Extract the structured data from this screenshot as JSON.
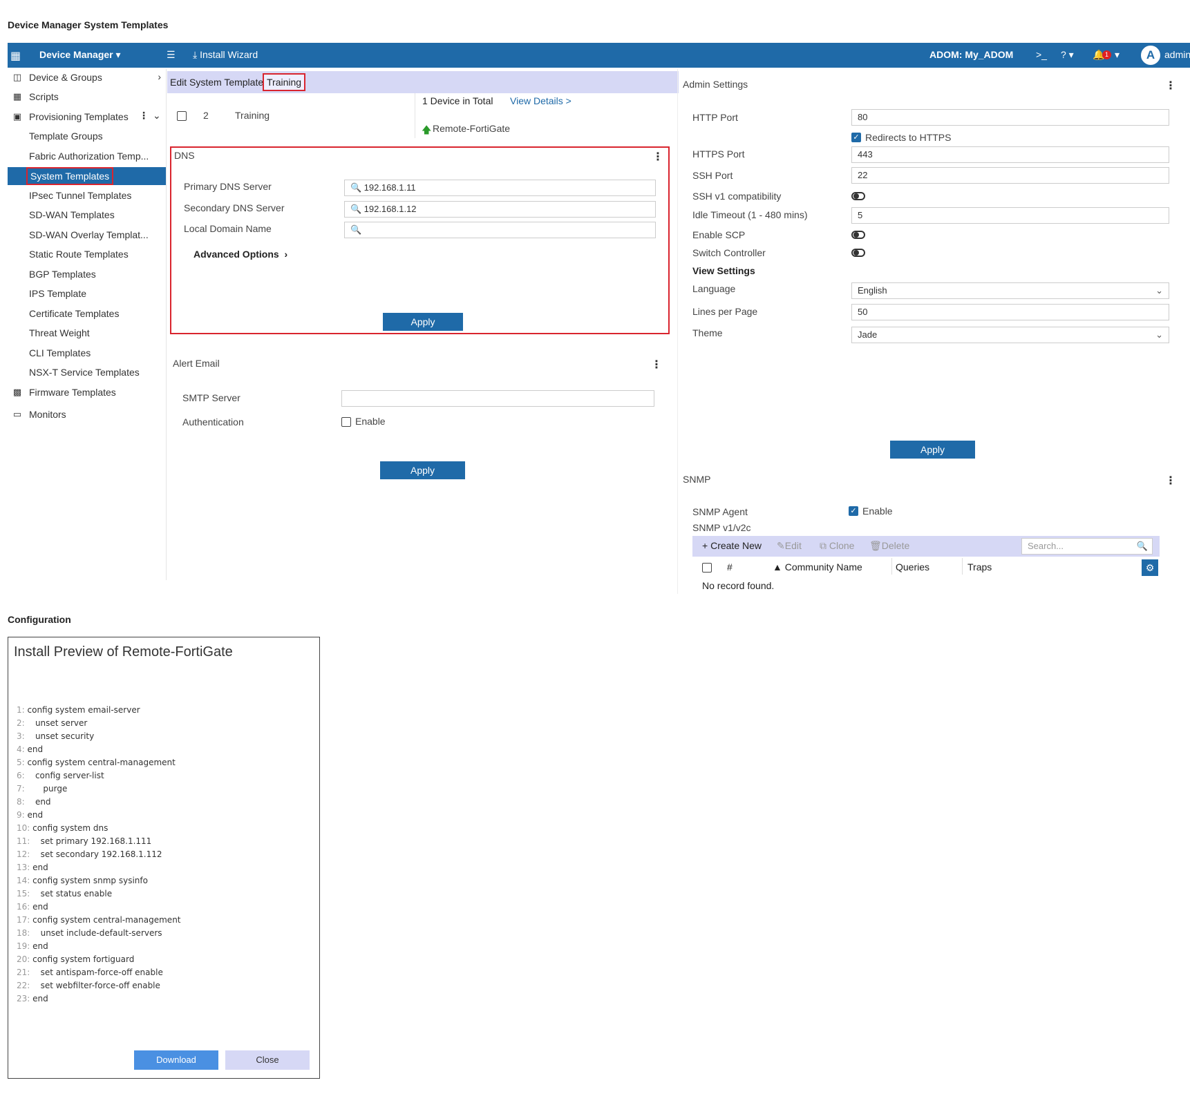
{
  "page_title": "Device Manager System Templates",
  "topbar": {
    "app": "Device Manager",
    "install_wizard": "Install Wizard",
    "adom": "ADOM: My_ADOM",
    "cli": ">_",
    "help": "?",
    "notif_count": "1",
    "avatar": "A",
    "user": "admin"
  },
  "sidebar": {
    "items": [
      {
        "label": "Device & Groups",
        "icon": "device-icon"
      },
      {
        "label": "Scripts",
        "icon": "script-icon"
      },
      {
        "label": "Provisioning Templates",
        "icon": "template-icon"
      },
      {
        "label": "Template Groups"
      },
      {
        "label": "Fabric Authorization Temp..."
      },
      {
        "label": "System Templates"
      },
      {
        "label": "IPsec Tunnel Templates"
      },
      {
        "label": "SD-WAN Templates"
      },
      {
        "label": "SD-WAN Overlay Templat..."
      },
      {
        "label": "Static Route Templates"
      },
      {
        "label": "BGP Templates"
      },
      {
        "label": "IPS Template"
      },
      {
        "label": "Certificate Templates"
      },
      {
        "label": "Threat Weight"
      },
      {
        "label": "CLI Templates"
      },
      {
        "label": "NSX-T Service Templates"
      },
      {
        "label": "Firmware Templates",
        "icon": "firmware-icon"
      },
      {
        "label": "Monitors",
        "icon": "monitor-icon"
      }
    ]
  },
  "edit_template": {
    "prefix": "Edit System Template",
    "name": "Training",
    "row_num": "2",
    "row_name": "Training",
    "devices_total": "1 Device in Total",
    "view_details": "View Details >",
    "device": "Remote-FortiGate"
  },
  "dns": {
    "title": "DNS",
    "primary_label": "Primary DNS Server",
    "primary_value": "192.168.1.11",
    "secondary_label": "Secondary DNS Server",
    "secondary_value": "192.168.1.12",
    "domain_label": "Local Domain Name",
    "domain_value": "",
    "advanced": "Advanced Options",
    "apply": "Apply"
  },
  "alert_email": {
    "title": "Alert Email",
    "smtp_label": "SMTP Server",
    "smtp_value": "",
    "auth_label": "Authentication",
    "auth_enable": "Enable",
    "apply": "Apply"
  },
  "admin": {
    "title": "Admin Settings",
    "http_label": "HTTP Port",
    "http_value": "80",
    "redirect_label": "Redirects to HTTPS",
    "https_label": "HTTPS Port",
    "https_value": "443",
    "ssh_label": "SSH Port",
    "ssh_value": "22",
    "sshv1_label": "SSH v1 compatibility",
    "idle_label": "Idle Timeout (1 - 480 mins)",
    "idle_value": "5",
    "scp_label": "Enable SCP",
    "switch_label": "Switch Controller",
    "view_settings": "View Settings",
    "language_label": "Language",
    "language_value": "English",
    "lines_label": "Lines per Page",
    "lines_value": "50",
    "theme_label": "Theme",
    "theme_value": "Jade",
    "apply": "Apply"
  },
  "snmp": {
    "title": "SNMP",
    "agent_label": "SNMP Agent",
    "agent_enable": "Enable",
    "v1v2c": "SNMP v1/v2c",
    "create_new": "Create New",
    "edit": "Edit",
    "clone": "Clone",
    "delete": "Delete",
    "search_placeholder": "Search...",
    "col_num": "#",
    "col_name": "▲ Community Name",
    "col_queries": "Queries",
    "col_traps": "Traps",
    "empty": "No record found."
  },
  "configuration": {
    "title": "Configuration",
    "preview_title": "Install Preview of Remote-FortiGate",
    "lines": [
      {
        "n": "1:",
        "t": "config system email-server"
      },
      {
        "n": "2:",
        "t": "   unset server"
      },
      {
        "n": "3:",
        "t": "   unset security"
      },
      {
        "n": "4:",
        "t": "end"
      },
      {
        "n": "5:",
        "t": "config system central-management"
      },
      {
        "n": "6:",
        "t": "   config server-list"
      },
      {
        "n": "7:",
        "t": "      purge"
      },
      {
        "n": "8:",
        "t": "   end"
      },
      {
        "n": "9:",
        "t": "end"
      },
      {
        "n": "10:",
        "t": "config system dns"
      },
      {
        "n": "11:",
        "t": "   set primary 192.168.1.111"
      },
      {
        "n": "12:",
        "t": "   set secondary 192.168.1.112"
      },
      {
        "n": "13:",
        "t": "end"
      },
      {
        "n": "14:",
        "t": "config system snmp sysinfo"
      },
      {
        "n": "15:",
        "t": "   set status enable"
      },
      {
        "n": "16:",
        "t": "end"
      },
      {
        "n": "17:",
        "t": "config system central-management"
      },
      {
        "n": "18:",
        "t": "   unset include-default-servers"
      },
      {
        "n": "19:",
        "t": "end"
      },
      {
        "n": "20:",
        "t": "config system fortiguard"
      },
      {
        "n": "21:",
        "t": "   set antispam-force-off enable"
      },
      {
        "n": "22:",
        "t": "   set webfilter-force-off enable"
      },
      {
        "n": "23:",
        "t": "end"
      }
    ],
    "download": "Download",
    "close": "Close"
  },
  "colors": {
    "brand": "#1f6aa8",
    "highlight": "#d9242e",
    "strip": "#d6d8f5"
  }
}
